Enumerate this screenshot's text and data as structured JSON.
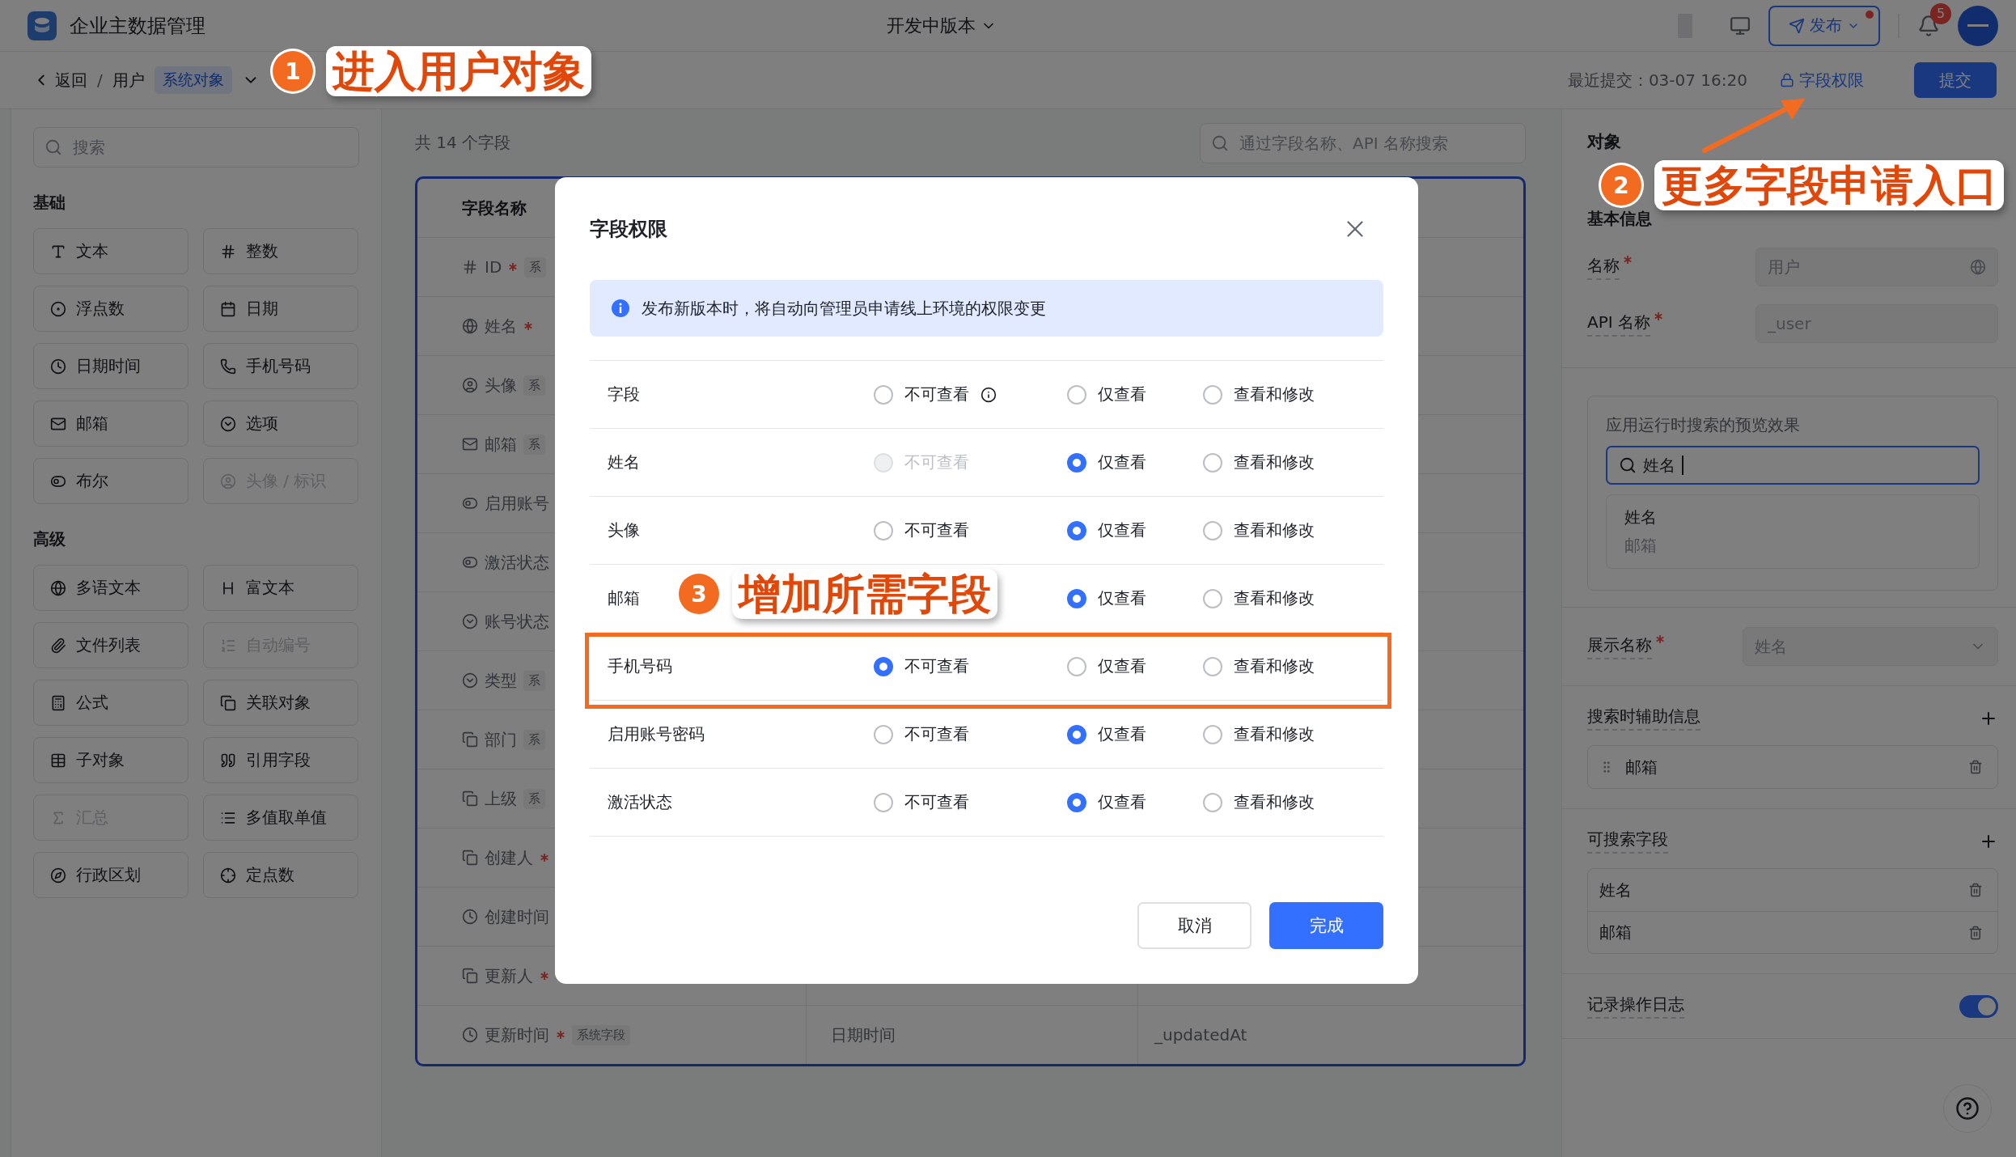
{
  "app": {
    "title": "企业主数据管理",
    "version": "开发中版本",
    "publish": "发布",
    "notifications": "5"
  },
  "breadcrumb": {
    "back": "返回",
    "separator": "/",
    "object": "用户",
    "tag": "系统对象"
  },
  "header_right": {
    "last_commit": "最近提交：03-07 16:20",
    "permissions_link": "字段权限",
    "submit": "提交"
  },
  "sidebar": {
    "search_placeholder": "搜索",
    "groups": [
      {
        "title": "基础",
        "items": [
          {
            "label": "文本",
            "disabled": false
          },
          {
            "label": "整数",
            "disabled": false
          },
          {
            "label": "浮点数",
            "disabled": false
          },
          {
            "label": "日期",
            "disabled": false
          },
          {
            "label": "日期时间",
            "disabled": false
          },
          {
            "label": "手机号码",
            "disabled": false
          },
          {
            "label": "邮箱",
            "disabled": false
          },
          {
            "label": "选项",
            "disabled": false
          },
          {
            "label": "布尔",
            "disabled": false
          },
          {
            "label": "头像 / 标识",
            "disabled": true
          }
        ]
      },
      {
        "title": "高级",
        "items": [
          {
            "label": "多语文本",
            "disabled": false
          },
          {
            "label": "富文本",
            "disabled": false
          },
          {
            "label": "文件列表",
            "disabled": false
          },
          {
            "label": "自动编号",
            "disabled": true
          },
          {
            "label": "公式",
            "disabled": false
          },
          {
            "label": "关联对象",
            "disabled": false
          },
          {
            "label": "子对象",
            "disabled": false
          },
          {
            "label": "引用字段",
            "disabled": false
          },
          {
            "label": "汇总",
            "disabled": true
          },
          {
            "label": "多值取单值",
            "disabled": false
          },
          {
            "label": "行政区划",
            "disabled": false
          },
          {
            "label": "定点数",
            "disabled": false
          }
        ]
      }
    ]
  },
  "fields": {
    "count": "共 14 个字段",
    "search_placeholder": "通过字段名称、API 名称搜索",
    "header": "字段名称",
    "rows": [
      {
        "name": "ID",
        "required": true,
        "tag": "系"
      },
      {
        "name": "姓名",
        "required": true
      },
      {
        "name": "头像",
        "required": false,
        "tag": "系"
      },
      {
        "name": "邮箱",
        "required": false,
        "tag": "系"
      },
      {
        "name": "启用账号",
        "required": false
      },
      {
        "name": "激活状态",
        "required": false
      },
      {
        "name": "账号状态",
        "required": false
      },
      {
        "name": "类型",
        "required": false,
        "tag": "系"
      },
      {
        "name": "部门",
        "required": false,
        "tag": "系"
      },
      {
        "name": "上级",
        "required": false,
        "tag": "系"
      },
      {
        "name": "创建人",
        "required": true
      },
      {
        "name": "创建时间",
        "required": false
      },
      {
        "name": "更新人",
        "required": true
      },
      {
        "name": "更新时间",
        "required": true,
        "tag": "系统字段",
        "type": "日期时间",
        "api": "_updatedAt"
      }
    ]
  },
  "object_panel": {
    "title": "对象",
    "section": "基本信息",
    "fields": [
      {
        "label": "名称",
        "required": true,
        "value": "用户"
      },
      {
        "label": "API 名称",
        "required": true,
        "value": "_user"
      }
    ],
    "preview": {
      "title": "应用运行时搜索的预览效果",
      "query": "姓名",
      "result_title": "姓名",
      "result_sub": "邮箱"
    },
    "display": {
      "label": "展示名称",
      "required": true,
      "value": "姓名"
    },
    "aux": {
      "title": "搜索时辅助信息",
      "items": [
        "邮箱"
      ]
    },
    "searchable": {
      "title": "可搜索字段",
      "items": [
        "姓名",
        "邮箱"
      ]
    },
    "log": {
      "label": "记录操作日志",
      "on": true
    }
  },
  "modal": {
    "title": "字段权限",
    "notice": "发布新版本时，将自动向管理员申请线上环境的权限变更",
    "rows": [
      {
        "label": "字段",
        "highlighted": false,
        "options": [
          {
            "label": "不可查看",
            "selected": false,
            "disabled": false,
            "info": true
          },
          {
            "label": "仅查看",
            "selected": false,
            "disabled": false
          },
          {
            "label": "查看和修改",
            "selected": false,
            "disabled": false
          }
        ]
      },
      {
        "label": "姓名",
        "highlighted": false,
        "options": [
          {
            "label": "不可查看",
            "selected": false,
            "disabled": true
          },
          {
            "label": "仅查看",
            "selected": true,
            "disabled": false
          },
          {
            "label": "查看和修改",
            "selected": false,
            "disabled": false
          }
        ]
      },
      {
        "label": "头像",
        "highlighted": false,
        "options": [
          {
            "label": "不可查看",
            "selected": false,
            "disabled": false
          },
          {
            "label": "仅查看",
            "selected": true,
            "disabled": false
          },
          {
            "label": "查看和修改",
            "selected": false,
            "disabled": false
          }
        ]
      },
      {
        "label": "邮箱",
        "highlighted": false,
        "options": [
          {
            "label": "仅查看",
            "selected": true,
            "disabled": false
          },
          {
            "label": "查看和修改",
            "selected": false,
            "disabled": false
          }
        ]
      },
      {
        "label": "手机号码",
        "highlighted": true,
        "options": [
          {
            "label": "不可查看",
            "selected": true,
            "disabled": false
          },
          {
            "label": "仅查看",
            "selected": false,
            "disabled": false
          },
          {
            "label": "查看和修改",
            "selected": false,
            "disabled": false
          }
        ]
      },
      {
        "label": "启用账号密码",
        "highlighted": false,
        "options": [
          {
            "label": "不可查看",
            "selected": false,
            "disabled": false
          },
          {
            "label": "仅查看",
            "selected": true,
            "disabled": false
          },
          {
            "label": "查看和修改",
            "selected": false,
            "disabled": false
          }
        ]
      },
      {
        "label": "激活状态",
        "highlighted": false,
        "options": [
          {
            "label": "不可查看",
            "selected": false,
            "disabled": false
          },
          {
            "label": "仅查看",
            "selected": true,
            "disabled": false
          },
          {
            "label": "查看和修改",
            "selected": false,
            "disabled": false
          }
        ]
      }
    ],
    "cancel": "取消",
    "confirm": "完成"
  },
  "annotations": [
    {
      "number": "1",
      "text": "进入用户对象"
    },
    {
      "number": "2",
      "text": "更多字段申请入口"
    },
    {
      "number": "3",
      "text": "增加所需字段"
    }
  ]
}
